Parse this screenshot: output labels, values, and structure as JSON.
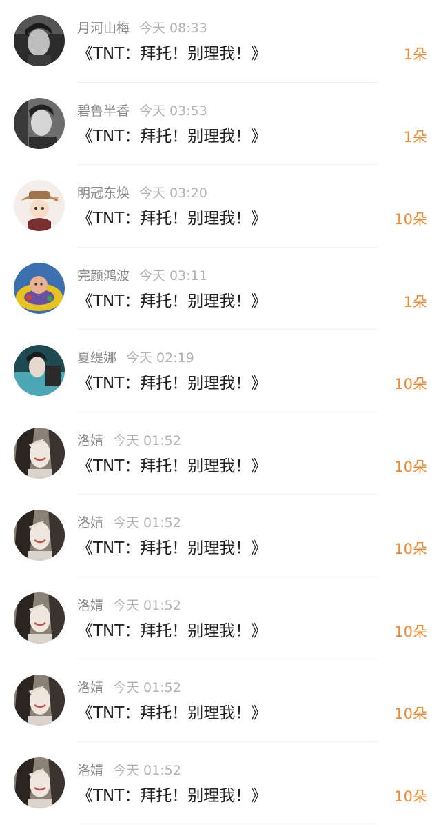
{
  "colors": {
    "accent": "#f28a33",
    "name": "#8a8a8a",
    "time": "#b2b2b2",
    "title": "#222222",
    "divider": "#f0f0f0"
  },
  "rows": [
    {
      "name": "月河山梅",
      "time": "今天 08:33",
      "title": "《TNT：拜托！别理我！》",
      "count": "1朵",
      "avatar": "avatar-boy-dark"
    },
    {
      "name": "碧鲁半香",
      "time": "今天 03:53",
      "title": "《TNT：拜托！别理我！》",
      "count": "1朵",
      "avatar": "avatar-boy-grey"
    },
    {
      "name": "明冠东焕",
      "time": "今天 03:20",
      "title": "《TNT：拜托！别理我！》",
      "count": "10朵",
      "avatar": "avatar-cartoon-hat"
    },
    {
      "name": "完颜鸿波",
      "time": "今天 03:11",
      "title": "《TNT：拜托！别理我！》",
      "count": "1朵",
      "avatar": "avatar-baby"
    },
    {
      "name": "夏缇娜",
      "time": "今天 02:19",
      "title": "《TNT：拜托！别理我！》",
      "count": "10朵",
      "avatar": "avatar-teal-boy"
    },
    {
      "name": "洛婧",
      "time": "今天 01:52",
      "title": "《TNT：拜托！别理我！》",
      "count": "10朵",
      "avatar": "avatar-girl"
    },
    {
      "name": "洛婧",
      "time": "今天 01:52",
      "title": "《TNT：拜托！别理我！》",
      "count": "10朵",
      "avatar": "avatar-girl"
    },
    {
      "name": "洛婧",
      "time": "今天 01:52",
      "title": "《TNT：拜托！别理我！》",
      "count": "10朵",
      "avatar": "avatar-girl"
    },
    {
      "name": "洛婧",
      "time": "今天 01:52",
      "title": "《TNT：拜托！别理我！》",
      "count": "10朵",
      "avatar": "avatar-girl"
    },
    {
      "name": "洛婧",
      "time": "今天 01:52",
      "title": "《TNT：拜托！别理我！》",
      "count": "10朵",
      "avatar": "avatar-girl"
    }
  ]
}
